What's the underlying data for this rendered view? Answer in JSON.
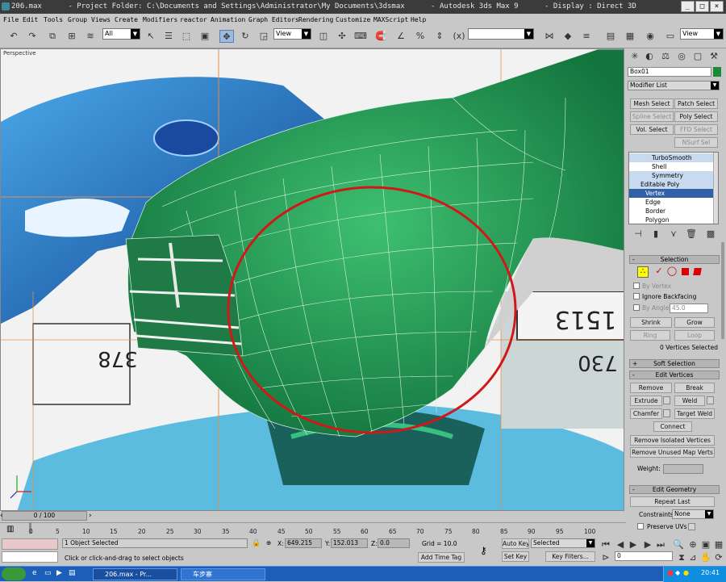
{
  "titlebar": {
    "title": "206.max      - Project Folder: C:\\Documents and Settings\\Administrator\\My Documents\\3dsmax      - Autodesk 3ds Max 9      - Display : Direct 3D"
  },
  "menu": [
    "File",
    "Edit",
    "Tools",
    "Group",
    "Views",
    "Create",
    "Modifiers",
    "reactor",
    "Animation",
    "Graph Editors",
    "Rendering",
    "Customize",
    "MAXScript",
    "Help"
  ],
  "toolbar": {
    "selection_filter": "All",
    "ref_coord": "View",
    "named_sel": "",
    "view2": "View"
  },
  "viewport": {
    "label": "Perspective",
    "plate_left": "378",
    "plate_right": "1513",
    "plate_bottom": "730"
  },
  "panel": {
    "object_name": "Box01",
    "modifier_list": "Modifier List",
    "buttons": {
      "mesh_select": "Mesh Select",
      "patch_select": "Patch Select",
      "spline_select": "Spline Select",
      "poly_select": "Poly Select",
      "vol_select": "Vol. Select",
      "ffd_select": "FFD Select",
      "nurbs_sel": "NSurf Sel"
    },
    "stack": [
      "TurboSmooth",
      "Shell",
      "Symmetry",
      "Editable Poly",
      "Vertex",
      "Edge",
      "Border",
      "Polygon"
    ],
    "selection": {
      "header": "Selection",
      "by_vertex": "By Vertex",
      "ignore_backfacing": "Ignore Backfacing",
      "by_angle": "By Angle:",
      "angle": "45.0",
      "shrink": "Shrink",
      "grow": "Grow",
      "ring": "Ring",
      "loop": "Loop",
      "status": "0 Vertices Selected"
    },
    "soft_selection": "Soft Selection",
    "edit_vertices": {
      "header": "Edit Vertices",
      "remove": "Remove",
      "break": "Break",
      "extrude": "Extrude",
      "weld": "Weld",
      "chamfer": "Chamfer",
      "target_weld": "Target Weld",
      "connect": "Connect",
      "remove_isolated": "Remove Isolated Vertices",
      "remove_unused": "Remove Unused Map Verts",
      "weight": "Weight:"
    },
    "edit_geometry": {
      "header": "Edit Geometry",
      "repeat_last": "Repeat Last",
      "constraints": "Constraints:",
      "constraints_val": "None",
      "preserve_uvs": "Preserve UVs"
    }
  },
  "timeline": {
    "slider": "0 / 100",
    "ticks": [
      "0",
      "5",
      "10",
      "15",
      "20",
      "25",
      "30",
      "35",
      "40",
      "45",
      "50",
      "55",
      "60",
      "65",
      "70",
      "75",
      "80",
      "85",
      "90",
      "95",
      "100"
    ]
  },
  "status": {
    "objects": "1 Object Selected",
    "prompt": "Click or click-and-drag to select objects",
    "x_label": "X:",
    "x": "649.215",
    "y_label": "Y:",
    "y": "152.013",
    "z_label": "Z:",
    "z": "0.0",
    "grid": "Grid = 10.0",
    "add_time_tag": "Add Time Tag",
    "auto_key": "Auto Key",
    "selected": "Selected",
    "set_key": "Set Key",
    "key_filters": "Key Filters...",
    "frame": "0"
  },
  "taskbar": {
    "task1": "206.max  - Pr...",
    "task2": "车步寨",
    "clock": "20:41"
  }
}
